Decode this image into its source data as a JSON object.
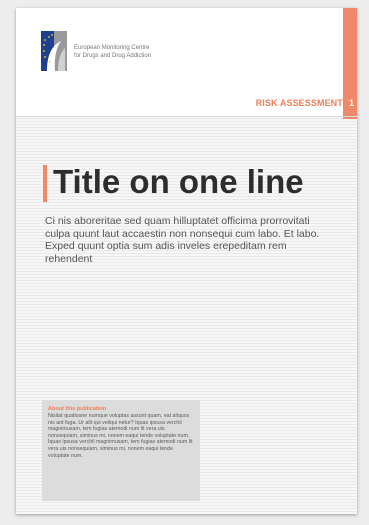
{
  "header": {
    "agency_line_1": "European Monitoring Centre",
    "agency_line_2": "for Drugs and Drug Addiction",
    "section_label": "RISK ASSESSMENTS",
    "page_number": "1"
  },
  "main": {
    "title": "Title on one line",
    "summary": "Ci nis aboreritae sed quam hilluptatet officima prorrovitati culpa quunt laut accaestin non nonsequi cum labo. Et labo. Exped quunt optia sum adis inveles erepeditam rem rehendent"
  },
  "about": {
    "title": "About this publication",
    "text": "Nisitat quatiosne numque voluptas assunt quam, eat aliquos nis ant fuga. Ur alit qui veliqui netur? Iquas ipsusa verchil magnimusam, tem fugias atemodi num lit vera uis nonsequiam, siminus mi, nonem eaqui tende voluptate num. Iquas ipsusa verchil magnimusam, tem fugias atemodi num lit vera uis nonsequiam, siminus mi, nonem eaqui tende voluptate num."
  },
  "colors": {
    "accent": "#f0896a",
    "logo_blue": "#1f3f8f",
    "logo_grey": "#9a9a9a",
    "title": "#2d2d2d"
  },
  "icons": {
    "logo": "emcdda-logo-icon"
  }
}
